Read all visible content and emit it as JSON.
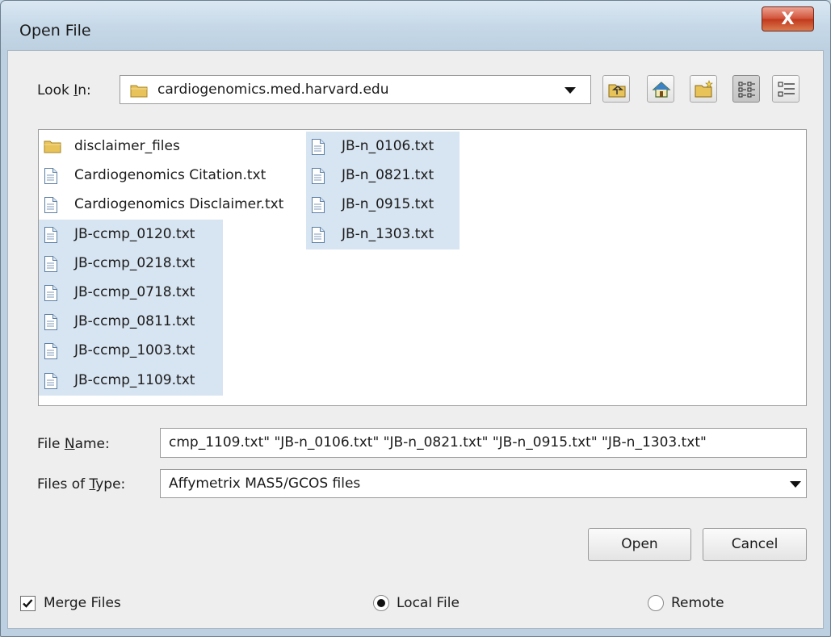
{
  "window": {
    "title": "Open File",
    "close_glyph": "X"
  },
  "look_in": {
    "label_prefix": "Look ",
    "label_mnemonic": "I",
    "label_suffix": "n:",
    "value": "cardiogenomics.med.harvard.edu",
    "icon": "folder-icon"
  },
  "toolbar": [
    "up-folder-icon",
    "home-icon",
    "new-folder-icon",
    "list-view-icon",
    "details-view-icon"
  ],
  "files": [
    {
      "name": "disclaimer_files",
      "type": "folder",
      "selected": false
    },
    {
      "name": "Cardiogenomics Citation.txt",
      "type": "file",
      "selected": false
    },
    {
      "name": "Cardiogenomics Disclaimer.txt",
      "type": "file",
      "selected": false
    },
    {
      "name": "JB-ccmp_0120.txt",
      "type": "file",
      "selected": true
    },
    {
      "name": "JB-ccmp_0218.txt",
      "type": "file",
      "selected": true
    },
    {
      "name": "JB-ccmp_0718.txt",
      "type": "file",
      "selected": true
    },
    {
      "name": "JB-ccmp_0811.txt",
      "type": "file",
      "selected": true
    },
    {
      "name": "JB-ccmp_1003.txt",
      "type": "file",
      "selected": true
    },
    {
      "name": "JB-ccmp_1109.txt",
      "type": "file",
      "selected": true
    },
    {
      "name": "JB-n_0106.txt",
      "type": "file",
      "selected": true
    },
    {
      "name": "JB-n_0821.txt",
      "type": "file",
      "selected": true
    },
    {
      "name": "JB-n_0915.txt",
      "type": "file",
      "selected": true
    },
    {
      "name": "JB-n_1303.txt",
      "type": "file",
      "selected": true
    }
  ],
  "file_name": {
    "label_prefix": "File ",
    "label_mnemonic": "N",
    "label_suffix": "ame:",
    "value": "cmp_1109.txt\" \"JB-n_0106.txt\" \"JB-n_0821.txt\" \"JB-n_0915.txt\" \"JB-n_1303.txt\""
  },
  "file_type": {
    "label_prefix": "Files of ",
    "label_mnemonic": "T",
    "label_suffix": "ype:",
    "value": "Affymetrix MAS5/GCOS files"
  },
  "buttons": {
    "open": "Open",
    "cancel": "Cancel"
  },
  "merge_files": {
    "label": "Merge Files",
    "checked": true
  },
  "source": {
    "local_label": "Local File",
    "remote_label": "Remote",
    "selected": "local"
  },
  "colors": {
    "selection": "#d7e4f1",
    "folder": "#e8c35a",
    "close_button": "#c7452a"
  }
}
